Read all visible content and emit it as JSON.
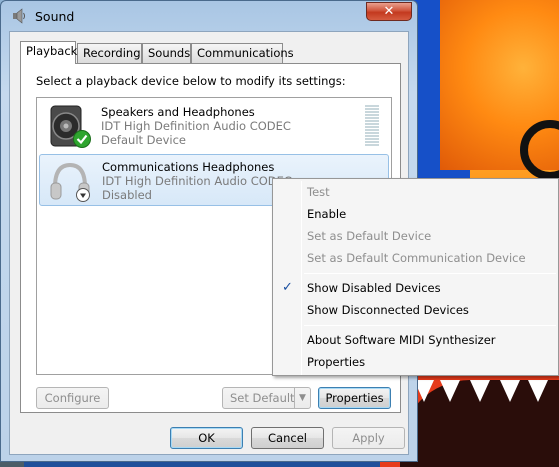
{
  "window": {
    "title": "Sound",
    "close_glyph": "✕"
  },
  "tabs": [
    {
      "label": "Playback"
    },
    {
      "label": "Recording"
    },
    {
      "label": "Sounds"
    },
    {
      "label": "Communications"
    }
  ],
  "playback": {
    "instruction": "Select a playback device below to modify its settings:",
    "devices": [
      {
        "name": "Speakers and Headphones",
        "driver": "IDT High Definition Audio CODEC",
        "status": "Default Device",
        "icon": "speaker-icon",
        "badge": "green-check-icon"
      },
      {
        "name": "Communications Headphones",
        "driver": "IDT High Definition Audio CODEC",
        "status": "Disabled",
        "icon": "headphones-icon",
        "badge": "disabled-arrow-icon"
      }
    ],
    "buttons": {
      "configure": "Configure",
      "set_default": "Set Default",
      "properties": "Properties"
    }
  },
  "footer": {
    "ok": "OK",
    "cancel": "Cancel",
    "apply": "Apply"
  },
  "context_menu": {
    "items": [
      {
        "label": "Test"
      },
      {
        "label": "Enable"
      },
      {
        "label": "Set as Default Device"
      },
      {
        "label": "Set as Default Communication Device"
      },
      {
        "label": "Show Disabled Devices"
      },
      {
        "label": "Show Disconnected Devices"
      },
      {
        "label": "About Software MIDI Synthesizer"
      },
      {
        "label": "Properties"
      }
    ],
    "check_glyph": "✓"
  },
  "colors": {
    "accent": "#3c7fb1",
    "selection": "#d7e8f8",
    "close": "#c3391f"
  }
}
